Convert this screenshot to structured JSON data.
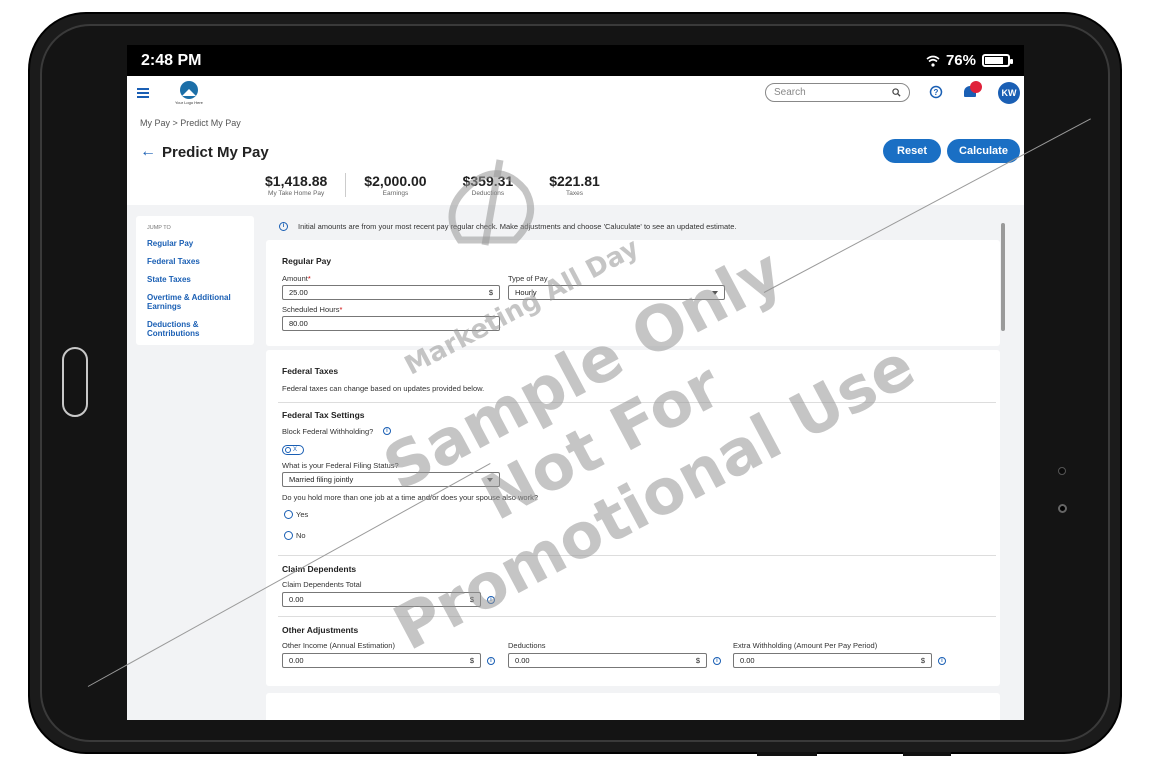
{
  "status_bar": {
    "time": "2:48 PM",
    "battery": "76%"
  },
  "header": {
    "logo_text": "Your Logo Here",
    "search_placeholder": "Search",
    "avatar_initials": "KW"
  },
  "breadcrumb": "My Pay > Predict My Pay",
  "page": {
    "title": "Predict My Pay",
    "reset_label": "Reset",
    "calculate_label": "Calculate"
  },
  "summary": [
    {
      "value": "$1,418.88",
      "label": "My Take Home Pay"
    },
    {
      "value": "$2,000.00",
      "label": "Earnings"
    },
    {
      "value": "$359.31",
      "label": "Deductions"
    },
    {
      "value": "$221.81",
      "label": "Taxes"
    }
  ],
  "jump_to": {
    "title": "JUMP TO",
    "links": [
      "Regular Pay",
      "Federal Taxes",
      "State Taxes",
      "Overtime & Additional Earnings",
      "Deductions & Contributions"
    ]
  },
  "info_message": "Initial amounts are from your most recent pay regular check. Make adjustments and choose 'Caluculate' to see an updated estimate.",
  "regular_pay": {
    "title": "Regular Pay",
    "amount_label": "Amount",
    "amount_value": "25.00",
    "currency": "$",
    "type_label": "Type of Pay",
    "type_value": "Hourly",
    "hours_label": "Scheduled Hours",
    "hours_value": "80.00"
  },
  "federal_taxes": {
    "title": "Federal Taxes",
    "desc": "Federal taxes can change based on updates provided below.",
    "settings_title": "Federal Tax Settings",
    "block_label": "Block Federal Withholding?",
    "toggle_label": "X",
    "filing_label": "What is your Federal Filing Status?",
    "filing_value": "Married filing jointly",
    "job_question": "Do you hold more than one job at a time and/or does your spouse also work?",
    "yes_label": "Yes",
    "no_label": "No",
    "dependents_title": "Claim Dependents",
    "dependents_label": "Claim Dependents Total",
    "dependents_value": "0.00",
    "adjustments_title": "Other Adjustments",
    "other_income_label": "Other Income (Annual Estimation)",
    "other_income_value": "0.00",
    "deductions_label": "Deductions",
    "deductions_value": "0.00",
    "extra_label": "Extra Withholding (Amount Per Pay Period)",
    "extra_value": "0.00"
  },
  "watermark": {
    "line1": "Marketing All Day",
    "line2": "Sample Only",
    "line3": "Not For",
    "line4": "Promotional Use"
  },
  "colors": {
    "primary": "#1a6fc4",
    "link": "#1a5fb4",
    "notification": "#e0213a",
    "background": "#f2f3f5"
  }
}
